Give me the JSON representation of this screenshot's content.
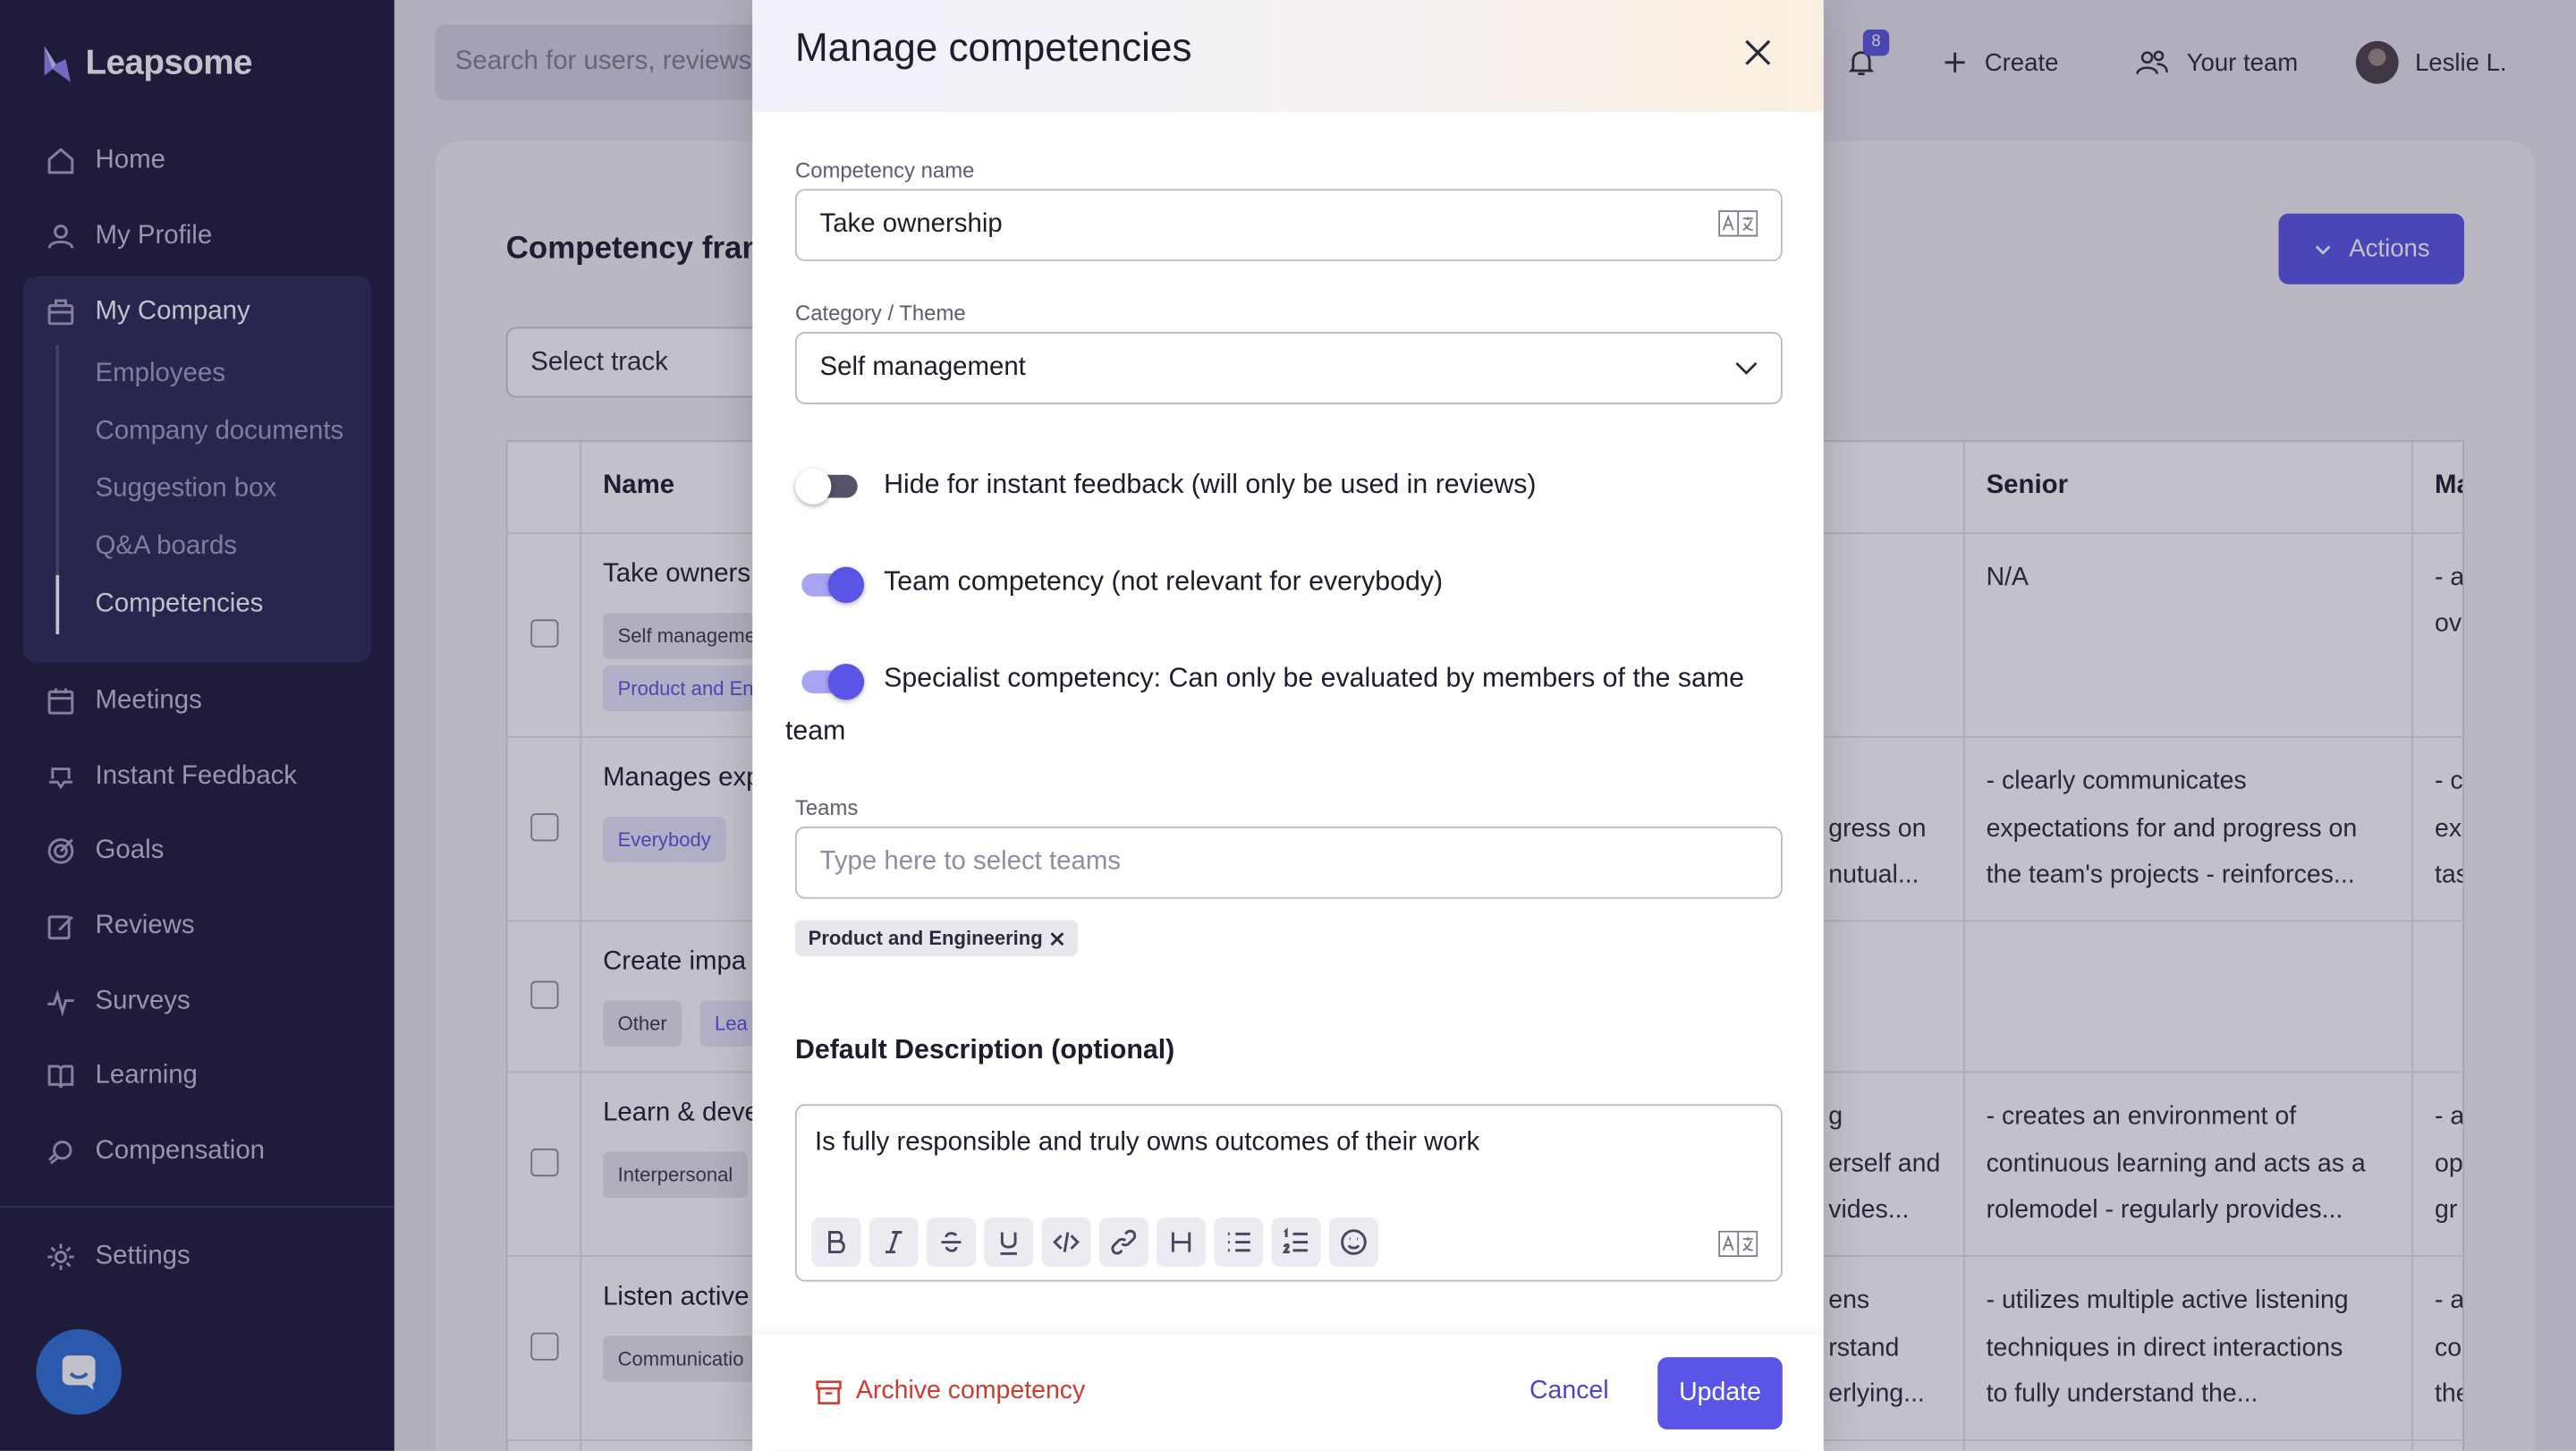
{
  "brand": {
    "name": "Leapsome"
  },
  "sidebar": {
    "items": [
      {
        "label": "Home",
        "icon": "home-icon"
      },
      {
        "label": "My Profile",
        "icon": "user-icon"
      },
      {
        "label": "My Company",
        "icon": "briefcase-icon"
      },
      {
        "label": "Meetings",
        "icon": "calendar-icon"
      },
      {
        "label": "Instant Feedback",
        "icon": "feedback-icon"
      },
      {
        "label": "Goals",
        "icon": "target-icon"
      },
      {
        "label": "Reviews",
        "icon": "edit-icon"
      },
      {
        "label": "Surveys",
        "icon": "pulse-icon"
      },
      {
        "label": "Learning",
        "icon": "book-icon"
      },
      {
        "label": "Compensation",
        "icon": "coins-icon"
      },
      {
        "label": "Settings",
        "icon": "gear-icon"
      }
    ],
    "company_sub": [
      "Employees",
      "Company documents",
      "Suggestion box",
      "Q&A boards",
      "Competencies"
    ]
  },
  "topbar": {
    "search_placeholder": "Search for users, reviews",
    "notification_count": "8",
    "create_label": "Create",
    "team_label": "Your team",
    "user_name": "Leslie L."
  },
  "page": {
    "title": "Competency fran",
    "select_track": "Select track",
    "actions_label": "Actions"
  },
  "table": {
    "headers": {
      "name": "Name",
      "senior": "Senior",
      "next": "Ma"
    },
    "rows": [
      {
        "name": "Take owners",
        "tags": [
          "Self manageme",
          "Product and En"
        ],
        "mid": [],
        "senior": [
          "N/A"
        ],
        "next": [
          "- a",
          "ov"
        ]
      },
      {
        "name": "Manages exp",
        "tags": [
          "Everybody"
        ],
        "mid": [
          "gress on",
          "nutual..."
        ],
        "senior": [
          "- clearly communicates",
          "expectations for and progress on",
          "the team's projects - reinforces..."
        ],
        "next": [
          "- c",
          "ex",
          "tas"
        ]
      },
      {
        "name": "Create impa",
        "tags": [
          "Other",
          "Lea"
        ],
        "mid": [],
        "senior": [],
        "next": []
      },
      {
        "name": "Learn & deve",
        "tags": [
          "Interpersonal"
        ],
        "mid": [
          "g",
          "erself and",
          "vides..."
        ],
        "senior": [
          "- creates an environment of",
          "continuous learning and acts as a",
          "rolemodel - regularly provides..."
        ],
        "next": [
          "- a",
          "op",
          "gr"
        ]
      },
      {
        "name": "Listen active",
        "tags": [
          "Communicatio"
        ],
        "mid": [
          "ens",
          "rstand",
          "erlying..."
        ],
        "senior": [
          "- utilizes multiple active listening",
          "techniques in direct interactions",
          "to fully understand the..."
        ],
        "next": [
          "- a",
          "co",
          "the"
        ]
      }
    ]
  },
  "modal": {
    "title": "Manage competencies",
    "competency_name_label": "Competency name",
    "competency_name_value": "Take ownership",
    "category_label": "Category / Theme",
    "category_value": "Self management",
    "toggles": [
      {
        "label": "Hide for instant feedback (will only be used in reviews)",
        "on": false
      },
      {
        "label": "Team competency (not relevant for everybody)",
        "on": true
      },
      {
        "label": "Specialist competency: Can only be evaluated by members of the same",
        "label_cont": "team",
        "on": true
      }
    ],
    "teams_label": "Teams",
    "teams_placeholder": "Type here to select teams",
    "selected_team": "Product and Engineering",
    "description_title": "Default Description (optional)",
    "description_value": "Is fully responsible and truly owns outcomes of their work",
    "toolbar": [
      "bold-icon",
      "italic-icon",
      "strikethrough-icon",
      "underline-icon",
      "code-icon",
      "link-icon",
      "heading-icon",
      "bullet-list-icon",
      "numbered-list-icon",
      "emoji-icon"
    ],
    "archive_label": "Archive competency",
    "cancel_label": "Cancel",
    "update_label": "Update"
  },
  "colors": {
    "accent": "#5a55e6",
    "sidebar": "#1d1b3a",
    "danger": "#d33a2f"
  }
}
